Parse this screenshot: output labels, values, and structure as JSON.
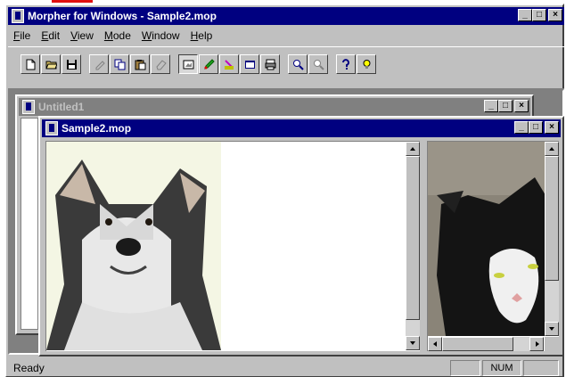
{
  "app": {
    "title": "Morpher for Windows - Sample2.mop"
  },
  "menu": [
    {
      "id": "file",
      "first": "F",
      "rest": "ile"
    },
    {
      "id": "edit",
      "first": "E",
      "rest": "dit"
    },
    {
      "id": "view",
      "first": "V",
      "rest": "iew"
    },
    {
      "id": "mode",
      "first": "M",
      "rest": "ode"
    },
    {
      "id": "window",
      "first": "W",
      "rest": "indow"
    },
    {
      "id": "help",
      "first": "H",
      "rest": "elp"
    }
  ],
  "toolbar": {
    "icons": [
      "new-file-icon",
      "open-folder-icon",
      "save-disk-icon",
      "undo-icon",
      "copy-icon",
      "paste-icon",
      "eraser-icon",
      "edit-source-icon",
      "pencil-icon",
      "target-edit-icon",
      "preview-icon",
      "render-icon",
      "zoom-in-icon",
      "zoom-out-icon",
      "help-icon",
      "hint-lightbulb-icon"
    ],
    "active": "edit-source-icon"
  },
  "windows": {
    "untitled": {
      "title": "Untitled1"
    },
    "sample": {
      "title": "Sample2.mop"
    }
  },
  "images": {
    "left": "dog-husky-image",
    "right": "cat-image"
  },
  "status": {
    "text": "Ready",
    "num": "NUM"
  },
  "colors": {
    "active_title": "#000080",
    "inactive_title": "#808080",
    "face": "#c0c0c0",
    "mdi_background": "#808080",
    "accent_red": "#e01010"
  }
}
